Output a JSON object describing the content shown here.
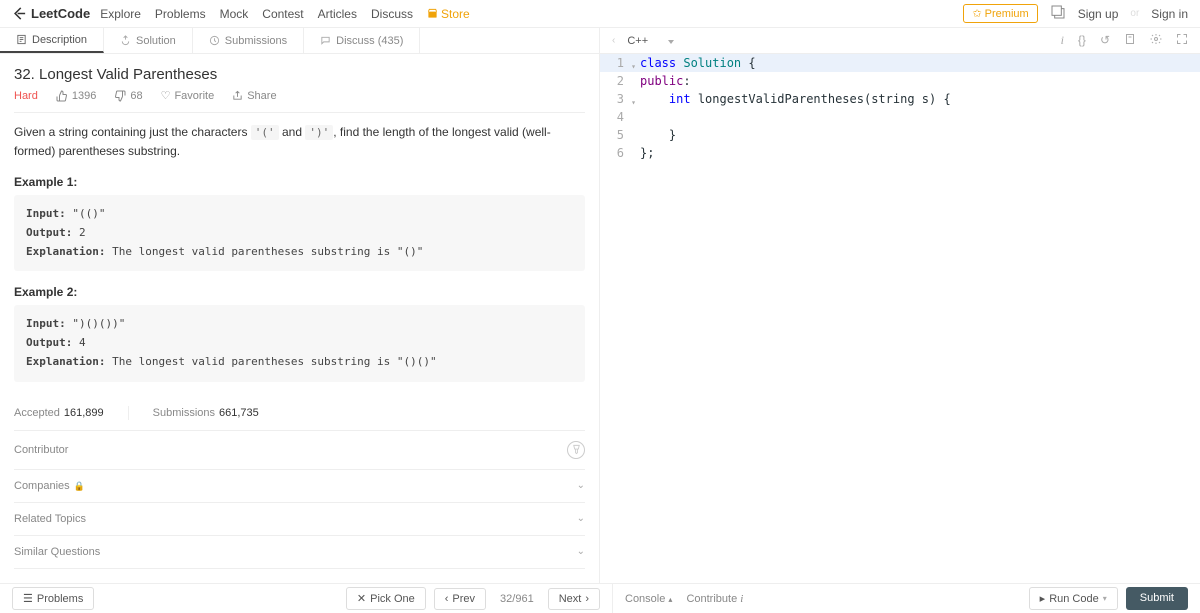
{
  "topnav": {
    "brand": "LeetCode",
    "links": [
      "Explore",
      "Problems",
      "Mock",
      "Contest",
      "Articles",
      "Discuss"
    ],
    "store": "Store",
    "premium": "Premium",
    "signup": "Sign up",
    "or": "or",
    "signin": "Sign in"
  },
  "tabs": {
    "description": "Description",
    "solution": "Solution",
    "submissions": "Submissions",
    "discuss": "Discuss (435)"
  },
  "editor": {
    "language": "C++",
    "lines": {
      "l1a": "class",
      "l1b": " Solution",
      "l1c": " {",
      "l2a": "public",
      "l2b": ":",
      "l3a": "    ",
      "l3b": "int",
      "l3c": " longestValidParentheses(string s) {",
      "l4": "        ",
      "l5": "    }",
      "l6": "};"
    }
  },
  "problem": {
    "title": "32. Longest Valid Parentheses",
    "difficulty": "Hard",
    "likes": "1396",
    "dislikes": "68",
    "favorite": "Favorite",
    "share": "Share",
    "desc_pre": "Given a string containing just the characters ",
    "char1": "'('",
    "desc_and": " and ",
    "char2": "')'",
    "desc_post": ", find the length of the longest valid (well-formed) parentheses substring.",
    "ex1_label": "Example 1:",
    "ex1_input_k": "Input:",
    "ex1_input_v": " \"(()\"",
    "ex1_output_k": "Output:",
    "ex1_output_v": " 2",
    "ex1_expl_k": "Explanation:",
    "ex1_expl_v": " The longest valid parentheses substring is \"()\"",
    "ex2_label": "Example 2:",
    "ex2_input_k": "Input:",
    "ex2_input_v": " \")()())\"",
    "ex2_output_k": "Output:",
    "ex2_output_v": " 4",
    "ex2_expl_k": "Explanation:",
    "ex2_expl_v": " The longest valid parentheses substring is \"()()\"",
    "accepted_label": "Accepted",
    "accepted": "161,899",
    "submissions_label": "Submissions",
    "submissions": "661,735",
    "contributor": "Contributor",
    "companies": "Companies",
    "related_topics": "Related Topics",
    "similar_questions": "Similar Questions"
  },
  "footer": {
    "problems": "Problems",
    "pick_one": "Pick One",
    "prev": "Prev",
    "indicator": "32/961",
    "next": "Next",
    "console": "Console",
    "contribute": "Contribute",
    "run_code": "Run Code",
    "submit": "Submit"
  }
}
